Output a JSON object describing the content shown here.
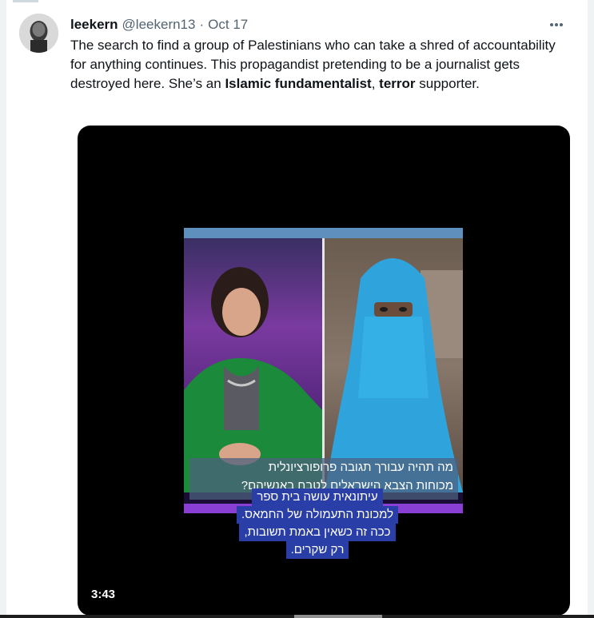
{
  "tweet": {
    "author_name": "leekern",
    "author_handle": "@leekern13",
    "separator": "·",
    "date": "Oct 17",
    "text_part1": "The search to find a group of Palestinians who can take a shred of accountability for anything continues. This propagandist pretending to be a journalist gets destroyed here. She’s an ",
    "text_bold1": "Islamic fundamentalist",
    "text_part2": ", ",
    "text_bold2": "terror",
    "text_part3": " supporter.",
    "more_icon": "more-horizontal-icon"
  },
  "video": {
    "caption_line1": "מה תהיה עבורך תגובה פרופורציונלית",
    "caption_line2": "מכוחות הצבא הישראלים לטבח באנשיהם?",
    "subtitle_lines": [
      "עיתונאית עושה בית ספר",
      "למכונת התעמולה של החמאס.",
      "ככה זה כשאין באמת תשובות,",
      "רק שקרים."
    ],
    "duration": "3:43"
  },
  "colors": {
    "text_primary": "#0f1419",
    "text_secondary": "#536471",
    "subtitle_bg": "#2a3ea8",
    "caption_bg": "#4c607e",
    "accent_bar": "#8a3fd4"
  }
}
